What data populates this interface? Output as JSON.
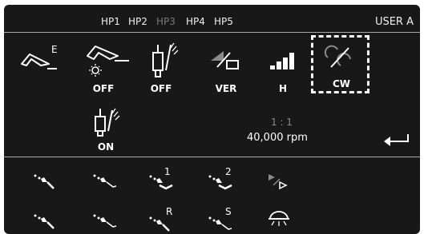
{
  "header": {
    "handpieces": [
      "HP1",
      "HP2",
      "HP3",
      "HP4",
      "HP5"
    ],
    "user": "USER A"
  },
  "settings": {
    "endo_label": "E",
    "light_label": "OFF",
    "spray_label": "OFF",
    "mode_label": "VER",
    "power_label": "H",
    "direction_label": "CW",
    "spray2_label": "ON"
  },
  "status": {
    "ratio": "1 : 1",
    "speed": "40,000 rpm"
  },
  "instrument_rows": {
    "row1_labels": [
      "",
      "",
      "1",
      "2",
      ""
    ],
    "row2_labels": [
      "",
      "",
      "R",
      "S",
      ""
    ]
  }
}
